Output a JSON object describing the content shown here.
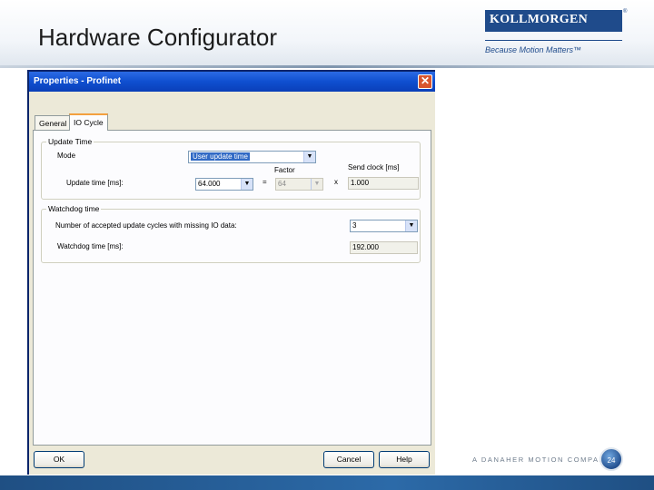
{
  "slide": {
    "title": "Hardware Configurator",
    "logo_text": "KOLLMORGEN",
    "logo_mark": "®",
    "tagline": "Because Motion Matters™",
    "footer_text": "A DANAHER MOTION COMPANY",
    "page_number": "24"
  },
  "dialog": {
    "title": "Properties - Profinet",
    "close_glyph": "✕",
    "tabs": [
      {
        "label": "General",
        "active": false
      },
      {
        "label": "IO Cycle",
        "active": true
      }
    ],
    "update_time": {
      "legend": "Update Time",
      "mode_label": "Mode",
      "mode_value": "User update time",
      "factor_label": "Factor",
      "send_clock_label": "Send clock [ms]",
      "update_time_label": "Update time [ms]:",
      "update_time_value": "64.000",
      "equals": "=",
      "factor_value": "64",
      "times": "x",
      "send_clock_value": "1.000"
    },
    "watchdog": {
      "legend": "Watchdog time",
      "cycles_label": "Number of accepted update cycles with missing IO data:",
      "cycles_value": "3",
      "wd_time_label": "Watchdog time [ms]:",
      "wd_time_value": "192.000"
    },
    "buttons": {
      "ok": "OK",
      "cancel": "Cancel",
      "help": "Help"
    },
    "dropdown_glyph": "▼"
  },
  "colors": {
    "brand": "#1f4b8b",
    "titlebar": "#0f4fd0",
    "selection": "#316ac5"
  }
}
